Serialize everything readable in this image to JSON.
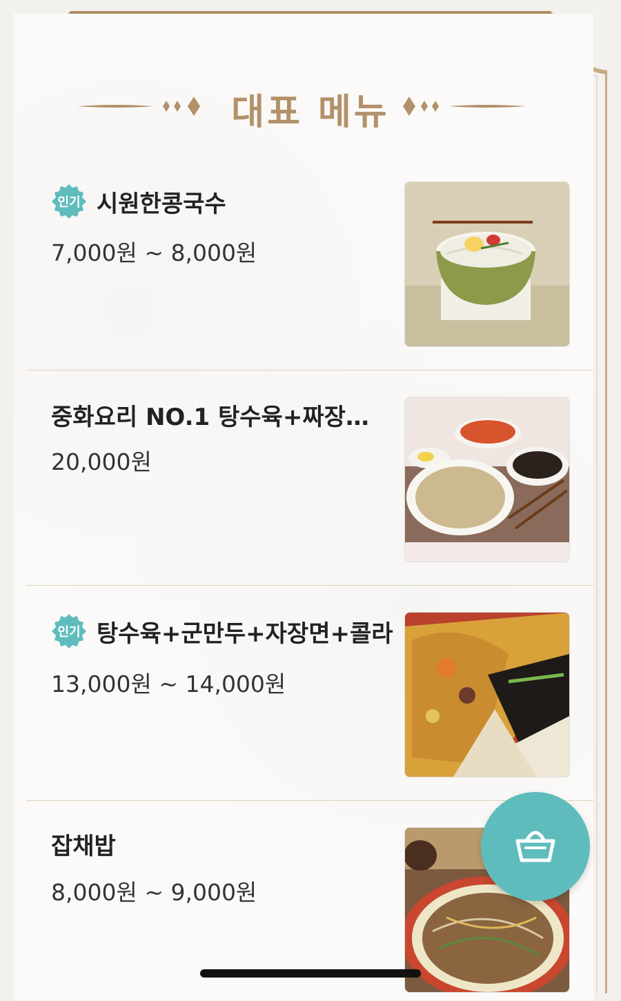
{
  "section": {
    "title": "대표 메뉴"
  },
  "colors": {
    "accent_gold": "#b2916a",
    "badge_teal": "#5fbcbc",
    "border": "#c9a983"
  },
  "menu_items": [
    {
      "badge": "인기",
      "name": "시원한콩국수",
      "price": "7,000원 ~ 8,000원",
      "image": "kongguksu-photo"
    },
    {
      "badge": "",
      "name": "중화요리 NO.1  탕수육+짜장2…",
      "price": "20,000원",
      "image": "tangsuyuk-set-photo"
    },
    {
      "badge": "인기",
      "name": "탕수육+군만두+자장면+콜라",
      "price": "13,000원 ~ 14,000원",
      "image": "chinese-combo-photo"
    },
    {
      "badge": "",
      "name": "잡채밥",
      "price": "8,000원 ~ 9,000원",
      "image": "japchae-rice-photo"
    }
  ],
  "cart": {
    "icon": "basket-icon"
  }
}
